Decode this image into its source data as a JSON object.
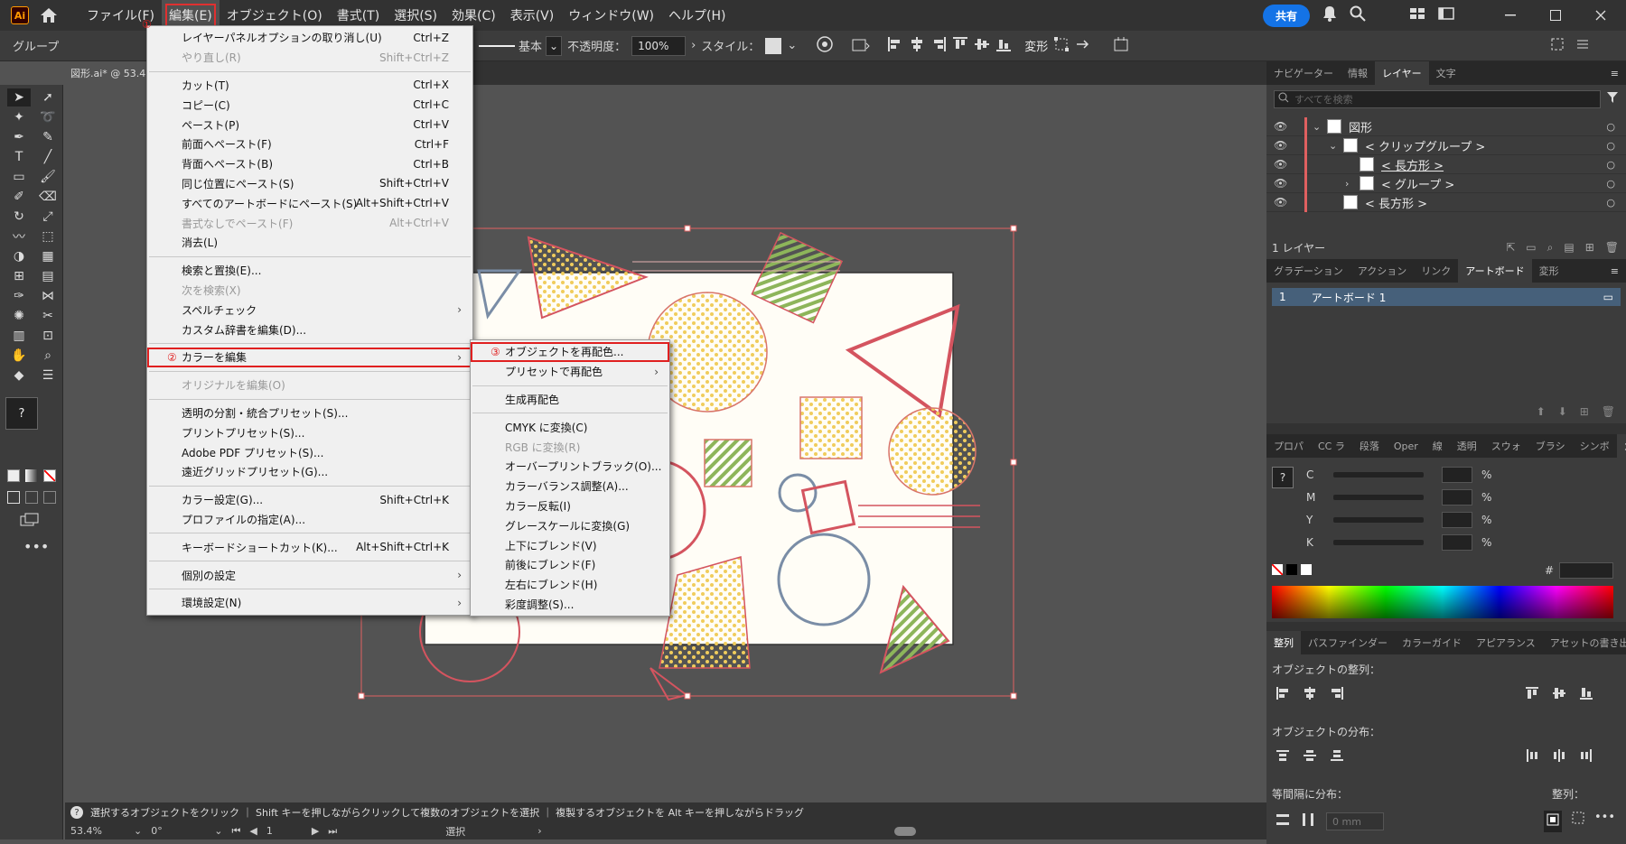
{
  "menubar": {
    "logo": "Ai",
    "items": [
      "ファイル(F)",
      "編集(E)",
      "オブジェクト(O)",
      "書式(T)",
      "選択(S)",
      "効果(C)",
      "表示(V)",
      "ウィンドウ(W)",
      "ヘルプ(H)"
    ],
    "active_index": 1,
    "share_label": "共有"
  },
  "control": {
    "selection_label": "グループ",
    "stroke_label": "基本",
    "opacity_label": "不透明度：",
    "opacity_value": "100%",
    "style_label": "スタイル：",
    "transform_label": "変形"
  },
  "doc": {
    "tab_label": "図形.ai* @ 53.4"
  },
  "edit_menu": {
    "callout_1": "①",
    "items": [
      {
        "label": "レイヤーパネルオプションの取り消し(U)",
        "shortcut": "Ctrl+Z",
        "disabled": false
      },
      {
        "label": "やり直し(R)",
        "shortcut": "Shift+Ctrl+Z",
        "disabled": true
      },
      {
        "sep": true
      },
      {
        "label": "カット(T)",
        "shortcut": "Ctrl+X",
        "disabled": false
      },
      {
        "label": "コピー(C)",
        "shortcut": "Ctrl+C",
        "disabled": false
      },
      {
        "label": "ペースト(P)",
        "shortcut": "Ctrl+V",
        "disabled": false
      },
      {
        "label": "前面へペースト(F)",
        "shortcut": "Ctrl+F",
        "disabled": false
      },
      {
        "label": "背面へペースト(B)",
        "shortcut": "Ctrl+B",
        "disabled": false
      },
      {
        "label": "同じ位置にペースト(S)",
        "shortcut": "Shift+Ctrl+V",
        "disabled": false
      },
      {
        "label": "すべてのアートボードにペースト(S)",
        "shortcut": "Alt+Shift+Ctrl+V",
        "disabled": false
      },
      {
        "label": "書式なしでペースト(F)",
        "shortcut": "Alt+Ctrl+V",
        "disabled": true
      },
      {
        "label": "消去(L)",
        "shortcut": "",
        "disabled": false
      },
      {
        "sep": true
      },
      {
        "label": "検索と置換(E)...",
        "shortcut": "",
        "disabled": false
      },
      {
        "label": "次を検索(X)",
        "shortcut": "",
        "disabled": true
      },
      {
        "label": "スペルチェック",
        "shortcut": "",
        "disabled": false,
        "submenu": true
      },
      {
        "label": "カスタム辞書を編集(D)...",
        "shortcut": "",
        "disabled": false
      },
      {
        "sep": true
      },
      {
        "label": "カラーを編集",
        "shortcut": "",
        "disabled": false,
        "submenu": true,
        "highlight": true,
        "callout": "②"
      },
      {
        "sep": true
      },
      {
        "label": "オリジナルを編集(O)",
        "shortcut": "",
        "disabled": true
      },
      {
        "sep": true
      },
      {
        "label": "透明の分割・統合プリセット(S)...",
        "shortcut": "",
        "disabled": false
      },
      {
        "label": "プリントプリセット(S)...",
        "shortcut": "",
        "disabled": false
      },
      {
        "label": "Adobe PDF プリセット(S)...",
        "shortcut": "",
        "disabled": false
      },
      {
        "label": "遠近グリッドプリセット(G)...",
        "shortcut": "",
        "disabled": false
      },
      {
        "sep": true
      },
      {
        "label": "カラー設定(G)...",
        "shortcut": "Shift+Ctrl+K",
        "disabled": false
      },
      {
        "label": "プロファイルの指定(A)...",
        "shortcut": "",
        "disabled": false
      },
      {
        "sep": true
      },
      {
        "label": "キーボードショートカット(K)...",
        "shortcut": "Alt+Shift+Ctrl+K",
        "disabled": false
      },
      {
        "sep": true
      },
      {
        "label": "個別の設定",
        "shortcut": "",
        "disabled": false,
        "submenu": true
      },
      {
        "sep": true
      },
      {
        "label": "環境設定(N)",
        "shortcut": "",
        "disabled": false,
        "submenu": true
      }
    ]
  },
  "color_submenu": {
    "items": [
      {
        "label": "オブジェクトを再配色...",
        "disabled": false,
        "highlight": true,
        "callout": "③"
      },
      {
        "label": "プリセットで再配色",
        "disabled": false,
        "submenu": true
      },
      {
        "sep": true
      },
      {
        "label": "生成再配色",
        "disabled": false
      },
      {
        "sep": true
      },
      {
        "label": "CMYK に変換(C)",
        "disabled": false
      },
      {
        "label": "RGB に変換(R)",
        "disabled": true
      },
      {
        "label": "オーバープリントブラック(O)...",
        "disabled": false
      },
      {
        "label": "カラーバランス調整(A)...",
        "disabled": false
      },
      {
        "label": "カラー反転(I)",
        "disabled": false
      },
      {
        "label": "グレースケールに変換(G)",
        "disabled": false
      },
      {
        "label": "上下にブレンド(V)",
        "disabled": false
      },
      {
        "label": "前後にブレンド(F)",
        "disabled": false
      },
      {
        "label": "左右にブレンド(H)",
        "disabled": false
      },
      {
        "label": "彩度調整(S)...",
        "disabled": false
      }
    ]
  },
  "layers_panel": {
    "tabs": [
      "ナビゲーター",
      "情報",
      "レイヤー",
      "文字"
    ],
    "active_tab": 2,
    "search_placeholder": "すべてを検索",
    "rows": [
      {
        "label": "図形",
        "indent": 0,
        "expanded": true
      },
      {
        "label": "< クリップグループ >",
        "indent": 1,
        "expanded": true
      },
      {
        "label": "< 長方形 >",
        "indent": 2,
        "underline": true
      },
      {
        "label": "< グループ >",
        "indent": 2,
        "collapsed": true
      },
      {
        "label": "< 長方形 >",
        "indent": 1
      }
    ],
    "footer": "1 レイヤー"
  },
  "artboard_panel": {
    "tabs": [
      "グラデーション",
      "アクション",
      "リンク",
      "アートボード",
      "変形"
    ],
    "active_tab": 3,
    "row_num": "1",
    "row_label": "アートボード 1"
  },
  "color_panel": {
    "tabs": [
      "プロパ",
      "CC ラ",
      "段落",
      "Oper",
      "線",
      "透明",
      "スウォ",
      "ブラシ",
      "シンボ",
      "カラー"
    ],
    "active_tab": 9,
    "channels": [
      "C",
      "M",
      "Y",
      "K"
    ],
    "unit": "%",
    "hex_label": "#"
  },
  "align_panel": {
    "tabs": [
      "整列",
      "パスファインダー",
      "カラーガイド",
      "アピアランス",
      "アセットの書き出し"
    ],
    "active_tab": 0,
    "align_label": "オブジェクトの整列：",
    "distribute_label": "オブジェクトの分布：",
    "spacing_label": "等間隔に分布：",
    "align_to_label": "整列：",
    "spacing_value": "0 mm"
  },
  "status": {
    "hint": "選択するオブジェクトをクリック ｜ Shift キーを押しながらクリックして複数のオブジェクトを選択 ｜ 複製するオブジェクトを Alt キーを押しながらドラッグ",
    "zoom": "53.4%",
    "angle": "0°",
    "page": "1",
    "tool": "選択"
  },
  "colors": {
    "red": "#d4545f",
    "blue": "#7a8da6",
    "yellow": "#f0cc5c",
    "green": "#8db55a",
    "artboard": "#fffdf6",
    "accent": "#1473e6"
  }
}
